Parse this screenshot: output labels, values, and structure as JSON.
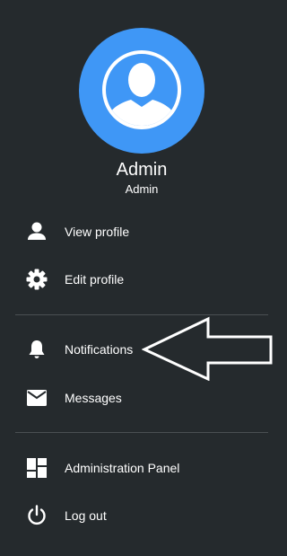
{
  "user": {
    "name": "Admin",
    "role": "Admin"
  },
  "menu": {
    "view_profile": "View profile",
    "edit_profile": "Edit profile",
    "notifications": "Notifications",
    "messages": "Messages",
    "administration_panel": "Administration Panel",
    "log_out": "Log out"
  },
  "icons": {
    "avatar": "user-avatar-icon",
    "view_profile": "person-icon",
    "edit_profile": "gear-icon",
    "notifications": "bell-icon",
    "messages": "envelope-icon",
    "administration_panel": "dashboard-icon",
    "log_out": "power-icon",
    "pointer": "arrow-left-outline"
  },
  "colors": {
    "background": "#252a2d",
    "avatar_blue": "#3f97f6",
    "text": "#ffffff",
    "divider": "#4a4f52"
  }
}
